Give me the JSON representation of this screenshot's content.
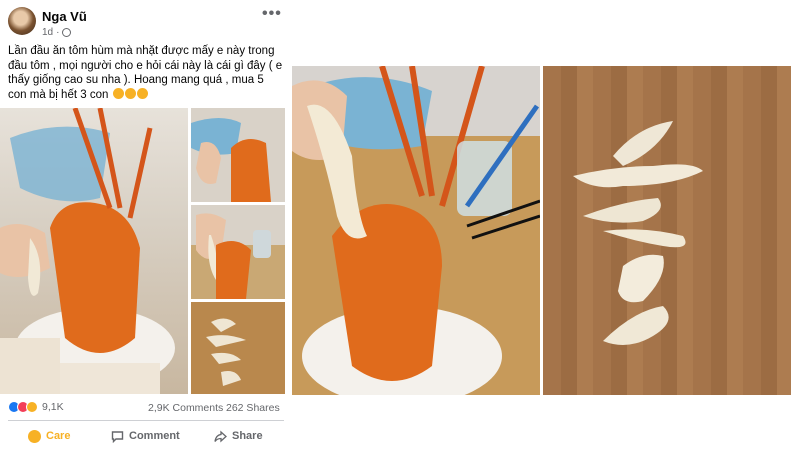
{
  "post": {
    "author": "Nga Vũ",
    "time": "1d",
    "separator": "·",
    "more": "•••",
    "text": "Lần đầu ăn tôm hùm mà nhặt được mấy e này trong đầu tôm , mọi người cho e hỏi cái này là cái gì đây ( e thấy giống cao su nha ). Hoang mang quá , mua 5 con mà bị hết 3 con"
  },
  "stats": {
    "reaction_count": "9,1K",
    "comments": "2,9K Comments",
    "shares": "262 Shares"
  },
  "actions": {
    "care": "Care",
    "comment": "Comment",
    "share": "Share"
  },
  "colors": {
    "care": "#f7b125",
    "like": "#1877f2",
    "love": "#f33e58",
    "secondary_text": "#65676b"
  }
}
